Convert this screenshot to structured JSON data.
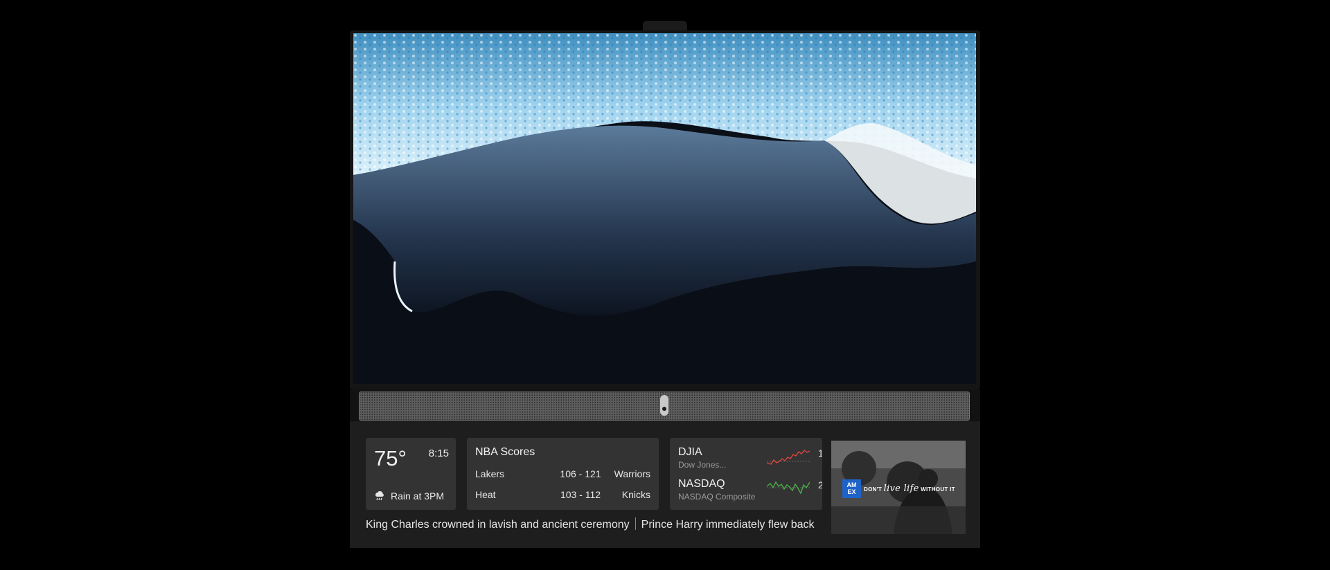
{
  "weather": {
    "temperature": "75°",
    "time": "8:15",
    "forecast": "Rain at 3PM",
    "icon": "rain-cloud-icon"
  },
  "nba": {
    "title": "NBA Scores",
    "games": [
      {
        "home": "Lakers",
        "score": "106 - 121",
        "away": "Warriors"
      },
      {
        "home": "Heat",
        "score": "103 - 112",
        "away": "Knicks"
      }
    ]
  },
  "stocks": [
    {
      "symbol": "DJIA",
      "name": "Dow Jones...",
      "trend_color": "#d9463e"
    },
    {
      "symbol": "NASDAQ",
      "name": "NASDAQ Composite",
      "trend_color": "#4cae4c"
    }
  ],
  "ticker": {
    "headlines": [
      "King Charles crowned in lavish and ancient ceremony",
      "Prince Harry immediately flew back"
    ]
  },
  "ad": {
    "logo": "AM EX",
    "tagline_prefix": "DON'T",
    "tagline_script": "live life",
    "tagline_suffix": "WITHOUT IT"
  }
}
